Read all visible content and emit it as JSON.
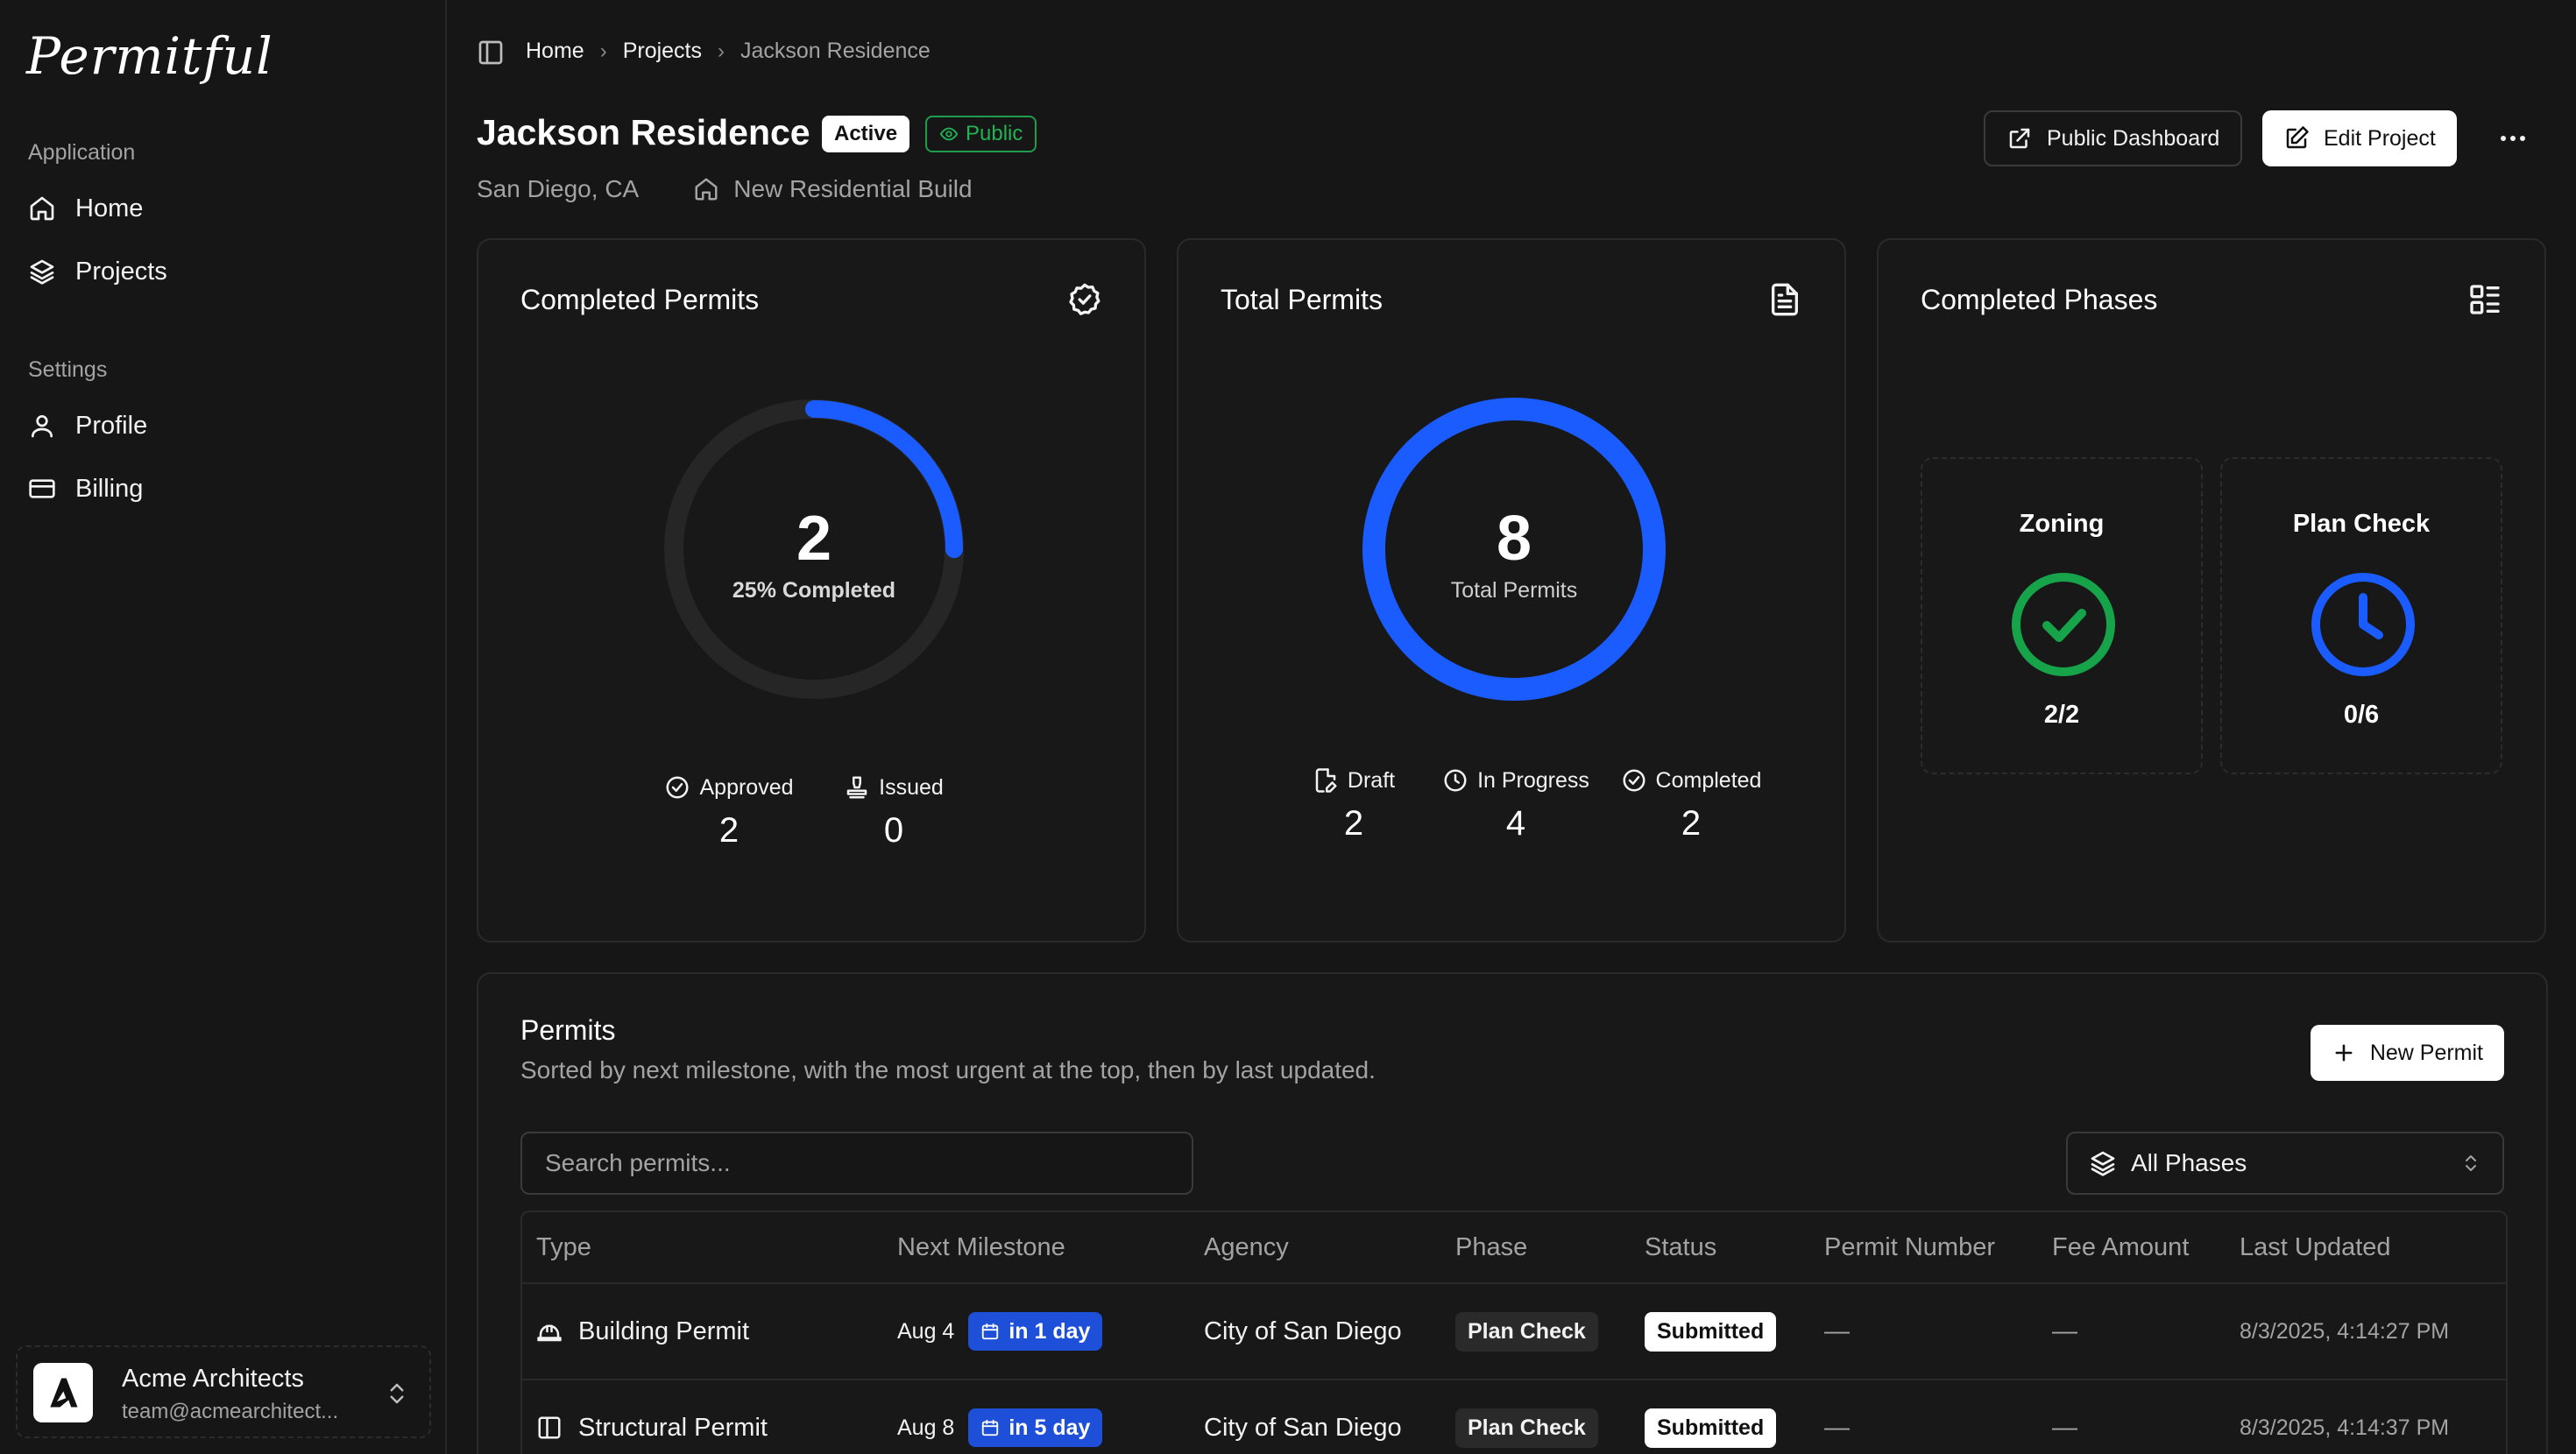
{
  "app": {
    "logo": "Permitful"
  },
  "sidebar": {
    "groups": [
      {
        "label": "Application",
        "items": [
          {
            "label": "Home",
            "icon": "home-icon"
          },
          {
            "label": "Projects",
            "icon": "layers-icon"
          }
        ]
      },
      {
        "label": "Settings",
        "items": [
          {
            "label": "Profile",
            "icon": "user-icon"
          },
          {
            "label": "Billing",
            "icon": "credit-card-icon"
          }
        ]
      }
    ],
    "account": {
      "name": "Acme Architects",
      "email": "team@acmearchitect..."
    }
  },
  "breadcrumb": {
    "items": [
      "Home",
      "Projects",
      "Jackson Residence"
    ]
  },
  "project": {
    "title": "Jackson Residence",
    "status_badge": "Active",
    "visibility_badge": "Public",
    "location": "San Diego, CA",
    "type": "New Residential Build"
  },
  "header_actions": {
    "public_dashboard": "Public Dashboard",
    "edit_project": "Edit Project"
  },
  "cards": {
    "completed_permits": {
      "title": "Completed Permits",
      "value": "2",
      "label": "25% Completed",
      "progress_fraction": 0.25,
      "stats": [
        {
          "label": "Approved",
          "value": "2"
        },
        {
          "label": "Issued",
          "value": "0"
        }
      ]
    },
    "total_permits": {
      "title": "Total Permits",
      "value": "8",
      "label": "Total Permits",
      "stats": [
        {
          "label": "Draft",
          "value": "2"
        },
        {
          "label": "In Progress",
          "value": "4"
        },
        {
          "label": "Completed",
          "value": "2"
        }
      ]
    },
    "completed_phases": {
      "title": "Completed Phases",
      "phases": [
        {
          "name": "Zoning",
          "value": "2/2",
          "state": "complete"
        },
        {
          "name": "Plan Check",
          "value": "0/6",
          "state": "in-progress"
        }
      ]
    }
  },
  "permits": {
    "title": "Permits",
    "subtitle": "Sorted by next milestone, with the most urgent at the top, then by last updated.",
    "new_button": "New Permit",
    "search_placeholder": "Search permits...",
    "phase_filter": "All Phases",
    "columns": [
      "Type",
      "Next Milestone",
      "Agency",
      "Phase",
      "Status",
      "Permit Number",
      "Fee Amount",
      "Last Updated"
    ],
    "rows": [
      {
        "type": "Building Permit",
        "icon": "hard-hat-icon",
        "milestone_date": "Aug 4",
        "milestone_due": "in 1 day",
        "agency": "City of San Diego",
        "phase": "Plan Check",
        "status": "Submitted",
        "permit_number": "—",
        "fee": "—",
        "updated": "8/3/2025, 4:14:27 PM"
      },
      {
        "type": "Structural Permit",
        "icon": "columns-icon",
        "milestone_date": "Aug 8",
        "milestone_due": "in 5 day",
        "agency": "City of San Diego",
        "phase": "Plan Check",
        "status": "Submitted",
        "permit_number": "—",
        "fee": "—",
        "updated": "8/3/2025, 4:14:37 PM"
      }
    ]
  },
  "colors": {
    "accent_blue": "#1a5cff",
    "success_green": "#16a34a",
    "background": "#161616"
  }
}
